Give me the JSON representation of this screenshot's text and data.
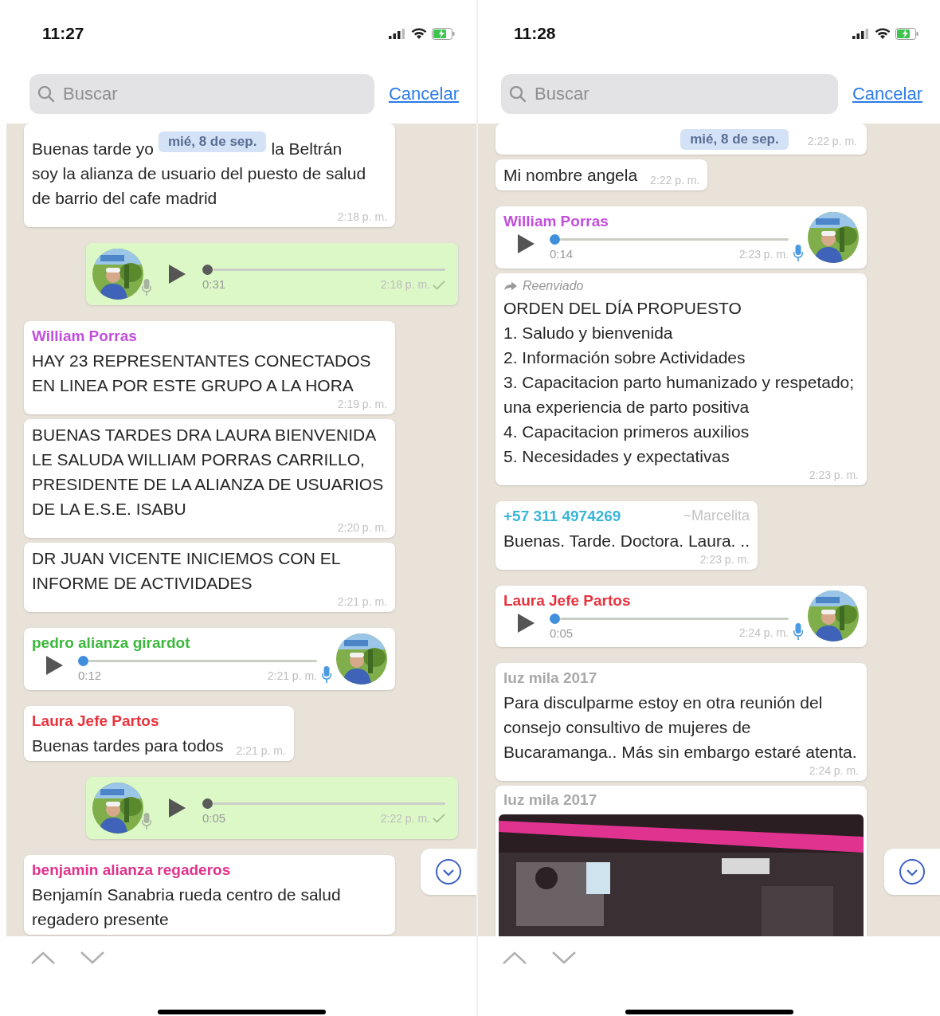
{
  "phones": [
    {
      "status_bar": {
        "time": "11:27"
      },
      "search": {
        "placeholder": "Buscar",
        "cancel": "Cancelar"
      },
      "date_badge": "mié, 8 de sep.",
      "messages": [
        {
          "kind": "text",
          "covered_start": "Buenas tarde yo",
          "covered_end": "la Beltrán",
          "text": "soy la alianza de usuario del puesto de salud de barrio del cafe madrid",
          "time": "2:18 p. m."
        },
        {
          "kind": "voice",
          "outgoing": true,
          "duration": "0:31",
          "time": "2:18 p. m.",
          "level": 0,
          "sent": true
        },
        {
          "kind": "text",
          "sender": "William Porras",
          "color": "#c24fdc",
          "text": "HAY 23 REPRESENTANTES CONECTADOS EN LINEA POR ESTE GRUPO A LA HORA",
          "time": "2:19 p. m."
        },
        {
          "kind": "text",
          "text": "BUENAS TARDES DRA LAURA BIENVENIDA LE SALUDA WILLIAM PORRAS CARRILLO, PRESIDENTE DE LA ALIANZA DE USUARIOS DE LA E.S.E. ISABU",
          "time": "2:20 p. m."
        },
        {
          "kind": "text",
          "text": "DR JUAN VICENTE INICIEMOS CON EL INFORME DE ACTIVIDADES",
          "time": "2:21 p. m."
        },
        {
          "kind": "voice",
          "outgoing": false,
          "sender": "pedro alianza girardot",
          "color": "#3cb83c",
          "duration": "0:12",
          "time": "2:21 p. m.",
          "level": 0
        },
        {
          "kind": "text",
          "sender": "Laura Jefe Partos",
          "color": "#e8323c",
          "text": "Buenas tardes para todos",
          "time": "2:21 p. m."
        },
        {
          "kind": "voice",
          "outgoing": true,
          "duration": "0:05",
          "time": "2:22 p. m.",
          "level": 0,
          "sent": true
        },
        {
          "kind": "text",
          "sender": "benjamin alianza regaderos",
          "color": "#e0328c",
          "text": "Benjamín Sanabria rueda centro de salud regadero presente"
        }
      ]
    },
    {
      "status_bar": {
        "time": "11:28"
      },
      "search": {
        "placeholder": "Buscar",
        "cancel": "Cancelar"
      },
      "date_badge": "mié, 8 de sep.",
      "messages": [
        {
          "kind": "text",
          "time": "2:22 p. m."
        },
        {
          "kind": "text",
          "text": "Mi nombre angela",
          "time": "2:22 p. m."
        },
        {
          "kind": "voice",
          "outgoing": false,
          "sender": "William Porras",
          "color": "#c24fdc",
          "duration": "0:14",
          "time": "2:23 p. m.",
          "level": 0
        },
        {
          "kind": "text",
          "forwarded": "Reenviado",
          "text": "ORDEN DEL DÍA PROPUESTO\n1. Saludo y bienvenida\n2. Información sobre Actividades\n3. Capacitacion parto humanizado y respetado; una experiencia de parto positiva\n4. Capacitacion primeros auxilios\n5. Necesidades y expectativas",
          "time": "2:23 p. m."
        },
        {
          "kind": "text",
          "sender": "+57 311 4974269",
          "color": "#3ab5d8",
          "push_name": "~Marcelita",
          "text": "Buenas. Tarde. Doctora. Laura. ..",
          "time": "2:23 p. m."
        },
        {
          "kind": "voice",
          "outgoing": false,
          "sender": "Laura Jefe Partos",
          "color": "#e8323c",
          "duration": "0:05",
          "time": "2:24 p. m.",
          "level": 0
        },
        {
          "kind": "text",
          "sender": "luz mila 2017",
          "color": "#a9a9a9",
          "text": "Para disculparme estoy en otra reunión del consejo consultivo de mujeres de Bucaramanga.. Más sin embargo estaré atenta.",
          "time": "2:24 p. m."
        },
        {
          "sender": "luz mila 2017",
          "color": "#a9a9a9"
        }
      ]
    }
  ]
}
